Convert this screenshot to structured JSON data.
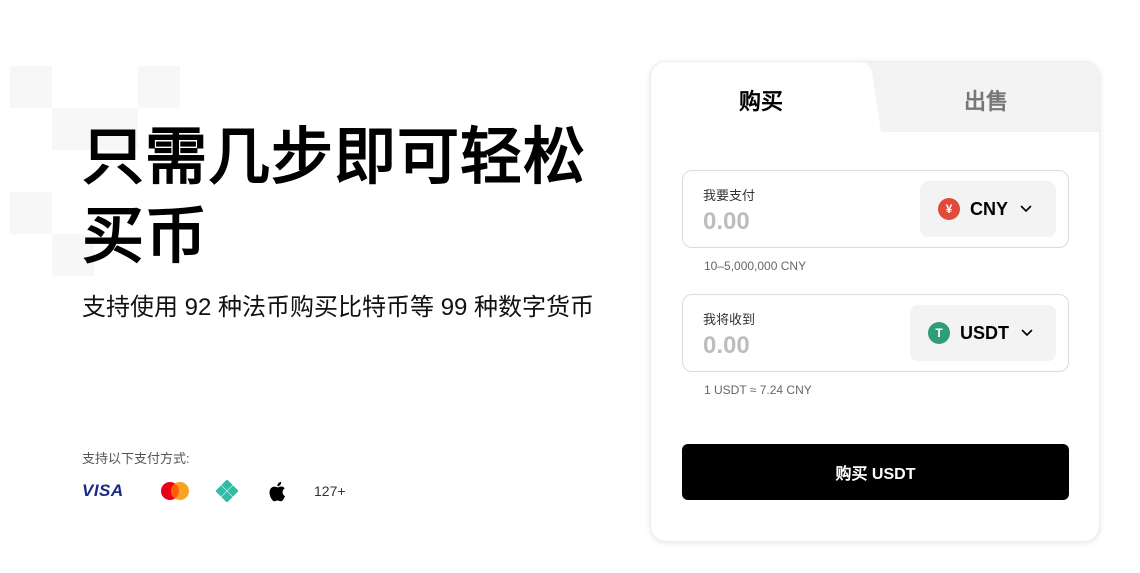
{
  "hero": {
    "title": "只需几步即可轻松买币",
    "subtitle": "支持使用 92 种法币购买比特币等 99 种数字货币"
  },
  "payments": {
    "label": "支持以下支付方式:",
    "visa": "VISA",
    "methods": [
      "visa-logo",
      "mastercard-icon",
      "diamond-icon",
      "apple-icon"
    ],
    "more": "127+"
  },
  "card": {
    "tabs": {
      "buy": "购买",
      "sell": "出售"
    },
    "pay": {
      "label": "我要支付",
      "placeholder": "0.00",
      "currency": "CNY",
      "currency_icon": "¥",
      "currency_color": "#e24a3b",
      "range": "10–5,000,000 CNY"
    },
    "receive": {
      "label": "我将收到",
      "placeholder": "0.00",
      "currency": "USDT",
      "currency_icon": "T",
      "currency_color": "#2f9e77",
      "rate": "1 USDT ≈ 7.24 CNY"
    },
    "submit": "购买 USDT"
  },
  "colors": {
    "primary_button": "#000000",
    "tab_inactive_bg": "#f3f3f3",
    "muted_text": "#bdbdbd"
  }
}
